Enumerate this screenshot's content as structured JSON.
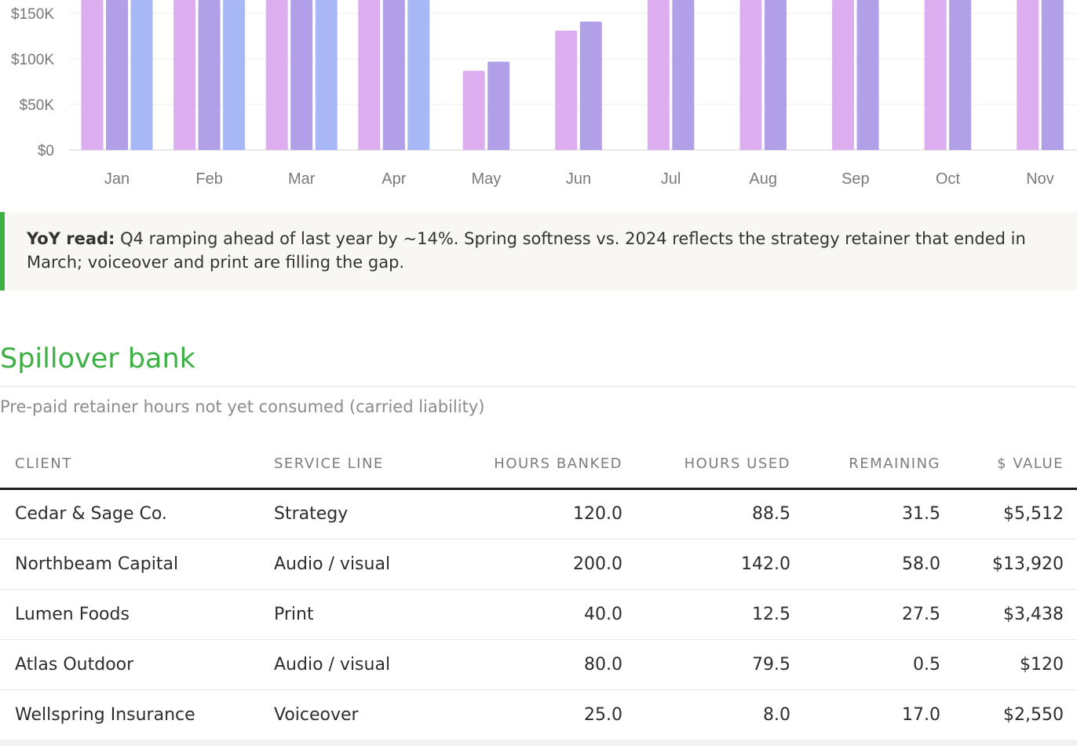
{
  "chart_data": {
    "type": "bar",
    "categories": [
      "Jan",
      "Feb",
      "Mar",
      "Apr",
      "May",
      "Jun",
      "Jul",
      "Aug",
      "Sep",
      "Oct",
      "Nov"
    ],
    "series": [
      {
        "color": "#dcaef0",
        "values": [
          165,
          165,
          165,
          165,
          87,
          131,
          165,
          165,
          165,
          165,
          165
        ]
      },
      {
        "color": "#b1a0e8",
        "values": [
          165,
          165,
          165,
          165,
          97,
          141,
          165,
          165,
          165,
          165,
          165
        ]
      },
      {
        "color": "#a8b7f5",
        "values": [
          165,
          165,
          165,
          165,
          null,
          null,
          null,
          null,
          null,
          null,
          null
        ]
      }
    ],
    "y_ticks": [
      "$0",
      "$50K",
      "$100K",
      "$150K"
    ],
    "y_tick_values": [
      0,
      50,
      100,
      150
    ],
    "y_unit": "$K",
    "grid": true
  },
  "callout": {
    "lead": "YoY read:",
    "text": " Q4 ramping ahead of last year by ~14%. Spring softness vs. 2024 reflects the strategy retainer that ended in March; voiceover and print are filling the gap."
  },
  "section": {
    "title": "Spillover bank",
    "subtitle": "Pre-paid retainer hours not yet consumed (carried liability)"
  },
  "table": {
    "headers": {
      "client": "CLIENT",
      "service": "SERVICE LINE",
      "banked": "HOURS BANKED",
      "used": "HOURS USED",
      "remaining": "REMAINING",
      "value": "$ VALUE"
    },
    "rows": [
      {
        "client": "Cedar & Sage Co.",
        "service": "Strategy",
        "banked": "120.0",
        "used": "88.5",
        "remaining": "31.5",
        "value": "$5,512"
      },
      {
        "client": "Northbeam Capital",
        "service": "Audio / visual",
        "banked": "200.0",
        "used": "142.0",
        "remaining": "58.0",
        "value": "$13,920"
      },
      {
        "client": "Lumen Foods",
        "service": "Print",
        "banked": "40.0",
        "used": "12.5",
        "remaining": "27.5",
        "value": "$3,438"
      },
      {
        "client": "Atlas Outdoor",
        "service": "Audio / visual",
        "banked": "80.0",
        "used": "79.5",
        "remaining": "0.5",
        "value": "$120"
      },
      {
        "client": "Wellspring Insurance",
        "service": "Voiceover",
        "banked": "25.0",
        "used": "8.0",
        "remaining": "17.0",
        "value": "$2,550"
      }
    ]
  }
}
